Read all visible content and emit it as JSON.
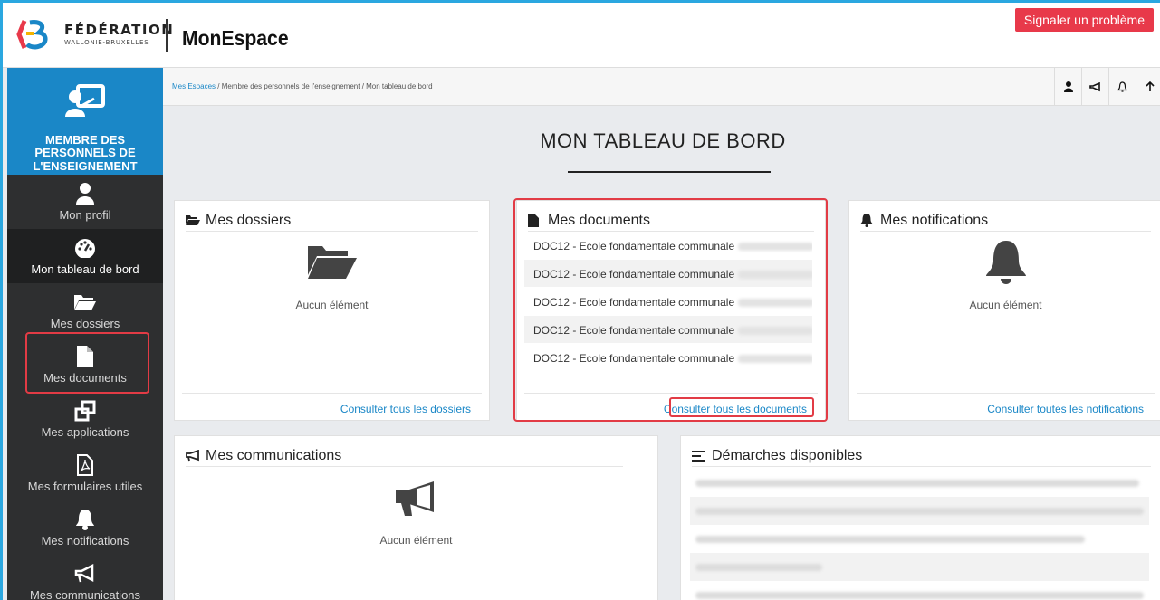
{
  "header": {
    "logo_line1": "FÉDÉRATION",
    "logo_line2": "WALLONIE-BRUXELLES",
    "app_title": "MonEspace",
    "report_button": "Signaler un problème"
  },
  "sidebar": {
    "role": "MEMBRE DES PERSONNELS DE L'ENSEIGNEMENT",
    "items": [
      {
        "label": "Mon profil",
        "icon": "user-icon"
      },
      {
        "label": "Mon tableau de bord",
        "icon": "dashboard-icon"
      },
      {
        "label": "Mes dossiers",
        "icon": "folder-icon"
      },
      {
        "label": "Mes documents",
        "icon": "document-icon"
      },
      {
        "label": "Mes applications",
        "icon": "applications-icon"
      },
      {
        "label": "Mes formulaires utiles",
        "icon": "pdf-icon"
      },
      {
        "label": "Mes notifications",
        "icon": "bell-icon"
      },
      {
        "label": "Mes communications",
        "icon": "megaphone-icon"
      }
    ]
  },
  "breadcrumb": {
    "items": [
      "Mes Espaces",
      "Membre des personnels de l'enseignement",
      "Mon tableau de bord"
    ]
  },
  "page_title": "MON TABLEAU DE BORD",
  "cards": {
    "dossiers": {
      "title": "Mes dossiers",
      "empty": "Aucun élément",
      "footer": "Consulter tous les dossiers"
    },
    "documents": {
      "title": "Mes documents",
      "rows": [
        "DOC12 - Ecole fondamentale communale",
        "DOC12 - Ecole fondamentale communale",
        "DOC12 - Ecole fondamentale communale",
        "DOC12 - Ecole fondamentale communale",
        "DOC12 - Ecole fondamentale communale"
      ],
      "footer": "Consulter tous les documents"
    },
    "notifications": {
      "title": "Mes notifications",
      "empty": "Aucun élément",
      "footer": "Consulter toutes les notifications"
    },
    "communications": {
      "title": "Mes communications",
      "empty": "Aucun élément"
    },
    "demarches": {
      "title": "Démarches disponibles"
    }
  },
  "colors": {
    "accent": "#1a87c7",
    "highlight": "#e23b45",
    "report": "#e8394a"
  }
}
